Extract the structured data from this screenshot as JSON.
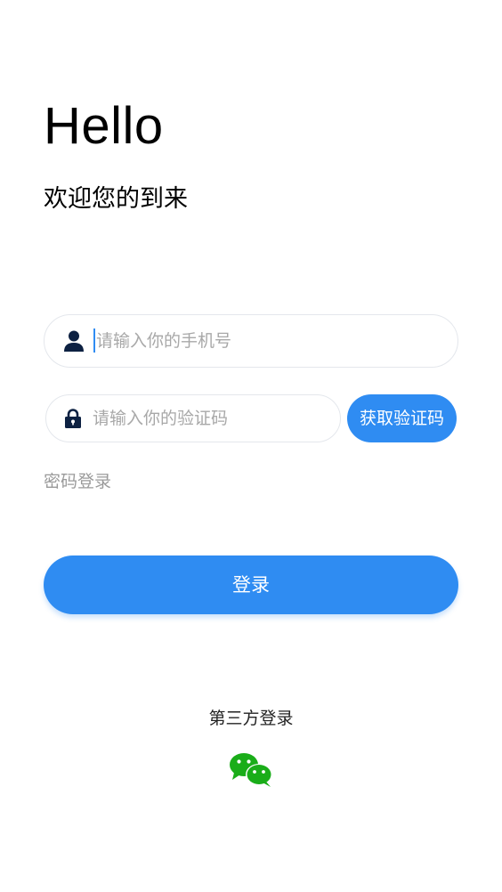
{
  "header": {
    "title": "Hello",
    "subtitle": "欢迎您的到来"
  },
  "form": {
    "phone": {
      "icon": "user-icon",
      "placeholder": "请输入你的手机号",
      "value": ""
    },
    "code": {
      "icon": "lock-icon",
      "placeholder": "请输入你的验证码",
      "value": ""
    },
    "get_code_label": "获取验证码",
    "password_login_label": "密码登录",
    "login_label": "登录"
  },
  "third_party": {
    "label": "第三方登录",
    "icons": [
      "wechat-icon"
    ]
  },
  "colors": {
    "accent": "#2f8cf2",
    "icon_dark": "#0d2142",
    "wechat_green": "#1aad19",
    "muted_text": "#9a9a9a"
  }
}
